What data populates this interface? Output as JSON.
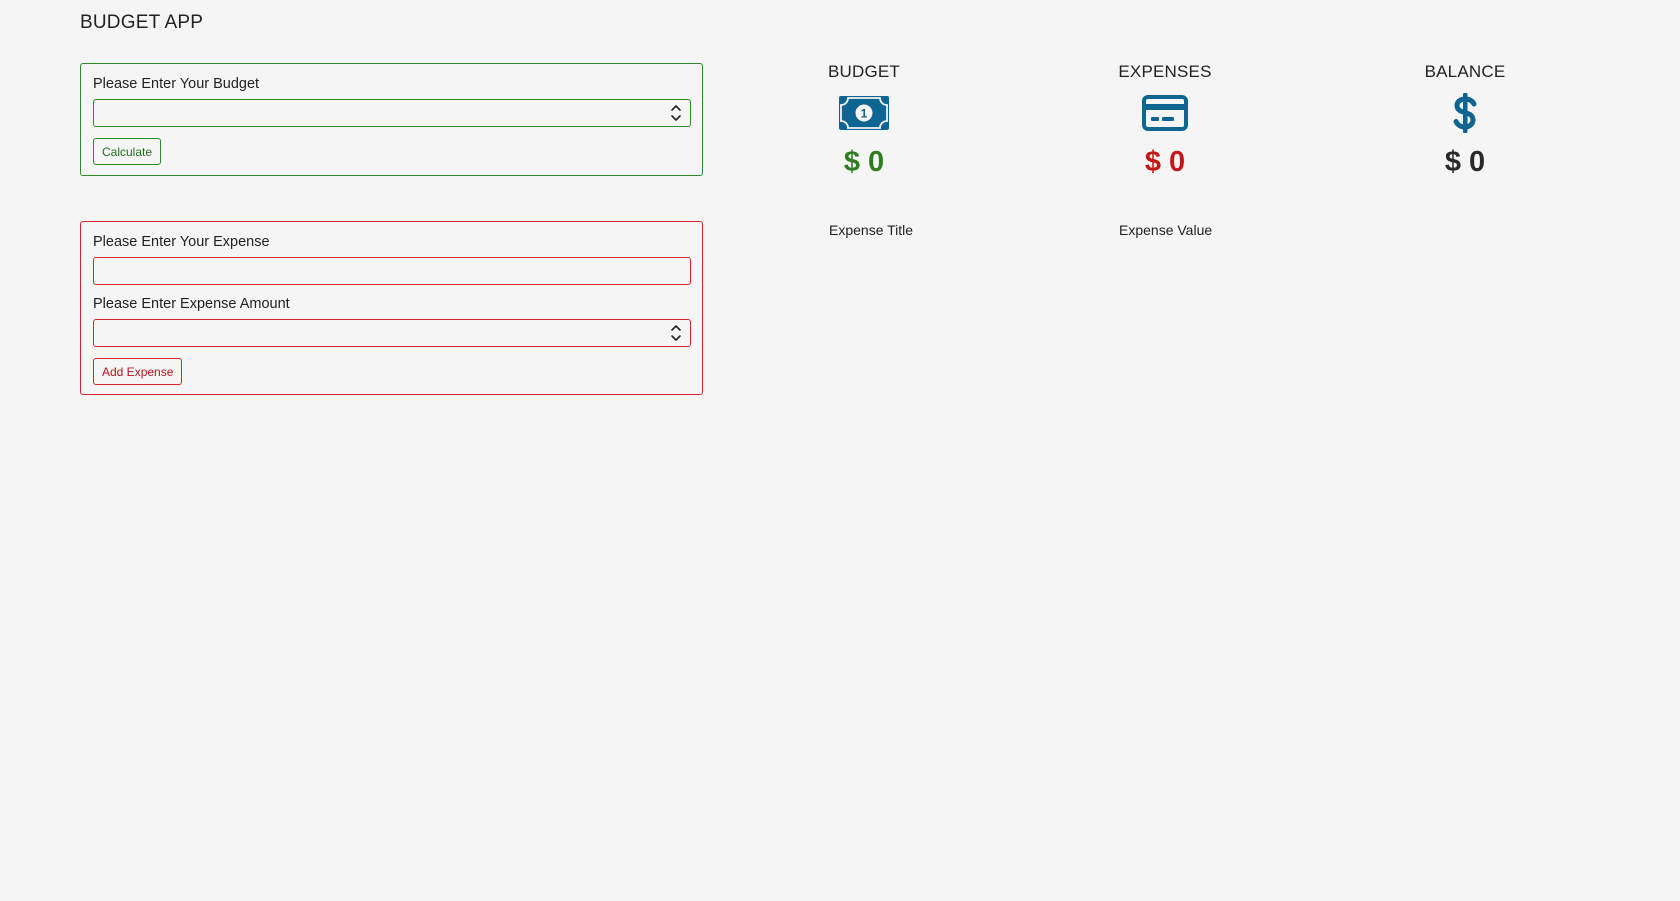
{
  "app": {
    "title": "BUDGET APP"
  },
  "budget_form": {
    "label": "Please Enter Your Budget",
    "input_value": "",
    "button_label": "Calculate"
  },
  "expense_form": {
    "title_label": "Please Enter Your Expense",
    "title_value": "",
    "amount_label": "Please Enter Expense Amount",
    "amount_value": "",
    "button_label": "Add Expense"
  },
  "summary": {
    "budget": {
      "title": "BUDGET",
      "icon": "money-bill-icon",
      "amount": "$ 0",
      "color": "#2e7d1f"
    },
    "expenses": {
      "title": "EXPENSES",
      "icon": "credit-card-icon",
      "amount": "$ 0",
      "color": "#c41818"
    },
    "balance": {
      "title": "BALANCE",
      "icon": "dollar-sign-icon",
      "amount": "$ 0",
      "color": "#2a2a2a"
    }
  },
  "expense_list": {
    "title_header": "Expense Title",
    "value_header": "Expense Value"
  },
  "colors": {
    "accent_green": "#2e8b2e",
    "accent_red": "#d4262b",
    "icon_blue": "#0f6591"
  }
}
